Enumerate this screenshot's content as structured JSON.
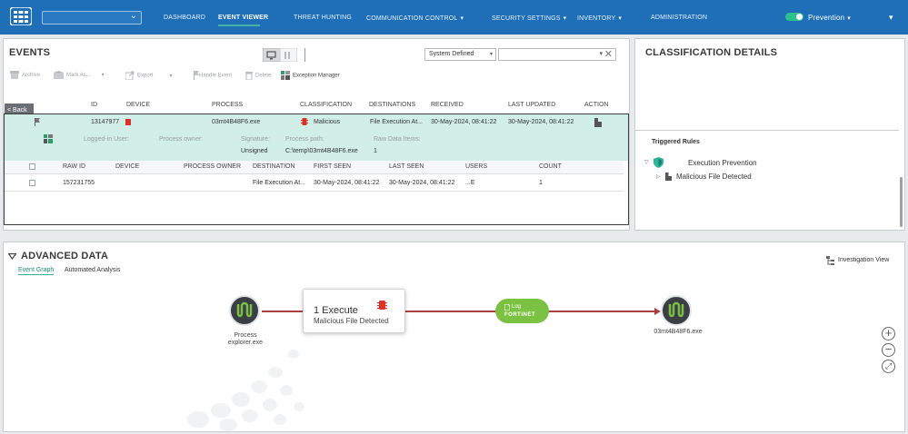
{
  "topbar": {
    "nav": [
      "DASHBOARD",
      "EVENT VIEWER",
      "THREAT HUNTING",
      "COMMUNICATION CONTROL",
      "SECURITY SETTINGS",
      "INVENTORY",
      "ADMINISTRATION"
    ],
    "active": "EVENT VIEWER",
    "mode": "Prevention"
  },
  "events": {
    "title": "EVENTS",
    "filter_value": "System Defined",
    "toolbar": [
      "Archive",
      "Mark As...",
      "Export",
      "Handle Event",
      "Delete",
      "Exception Manager"
    ],
    "back": "< Back",
    "columns": [
      "ID",
      "DEVICE",
      "PROCESS",
      "CLASSIFICATION",
      "DESTINATIONS",
      "RECEIVED",
      "LAST UPDATED",
      "ACTION"
    ],
    "row": {
      "id": "13147977",
      "process": "03mt4B48F6.exe",
      "classification": "Malicious",
      "destinations": "File Execution At...",
      "received": "30-May-2024, 08:41:22",
      "last_updated": "30-May-2024, 08:41:22"
    },
    "details": {
      "logged_in_user": "Logged-in User:",
      "process_owner": "Process owner:",
      "signature_label": "Signature:",
      "signature": "Unsigned",
      "process_path_label": "Process path:",
      "process_path": "C:\\temp\\03mt4B48F6.exe",
      "raw_items_label": "Raw Data Items:",
      "raw_items": "1"
    },
    "raw_columns": [
      "RAW ID",
      "DEVICE",
      "PROCESS OWNER",
      "DESTINATION",
      "FIRST SEEN",
      "LAST SEEN",
      "USERS",
      "COUNT"
    ],
    "raw_row": {
      "raw_id": "157231755",
      "destination": "File Execution At...",
      "first_seen": "30-May-2024, 08:41:22",
      "last_seen": "30-May-2024, 08:41:22",
      "users": "...E",
      "count": "1"
    }
  },
  "classification": {
    "title": "CLASSIFICATION DETAILS",
    "rules_title": "Triggered Rules",
    "rule_group": "Execution Prevention",
    "rule": "Malicious File Detected"
  },
  "advanced": {
    "title": "ADVANCED DATA",
    "tabs": [
      "Event Graph",
      "Automated Analysis"
    ],
    "investigation": "Investigation View",
    "graph": {
      "process_label_1": "Process",
      "process_label_2": "explorer.exe",
      "execute_title": "1 Execute",
      "execute_sub": "Malicious File Detected",
      "log_label": "Log",
      "log_brand": "FORTINET",
      "target": "03mt4B48F6.exe"
    }
  },
  "colors": {
    "topbar": "#1e6fb7",
    "teal": "#2bb59b",
    "malicious": "#d9322b",
    "selected_row": "#d2efe7"
  }
}
